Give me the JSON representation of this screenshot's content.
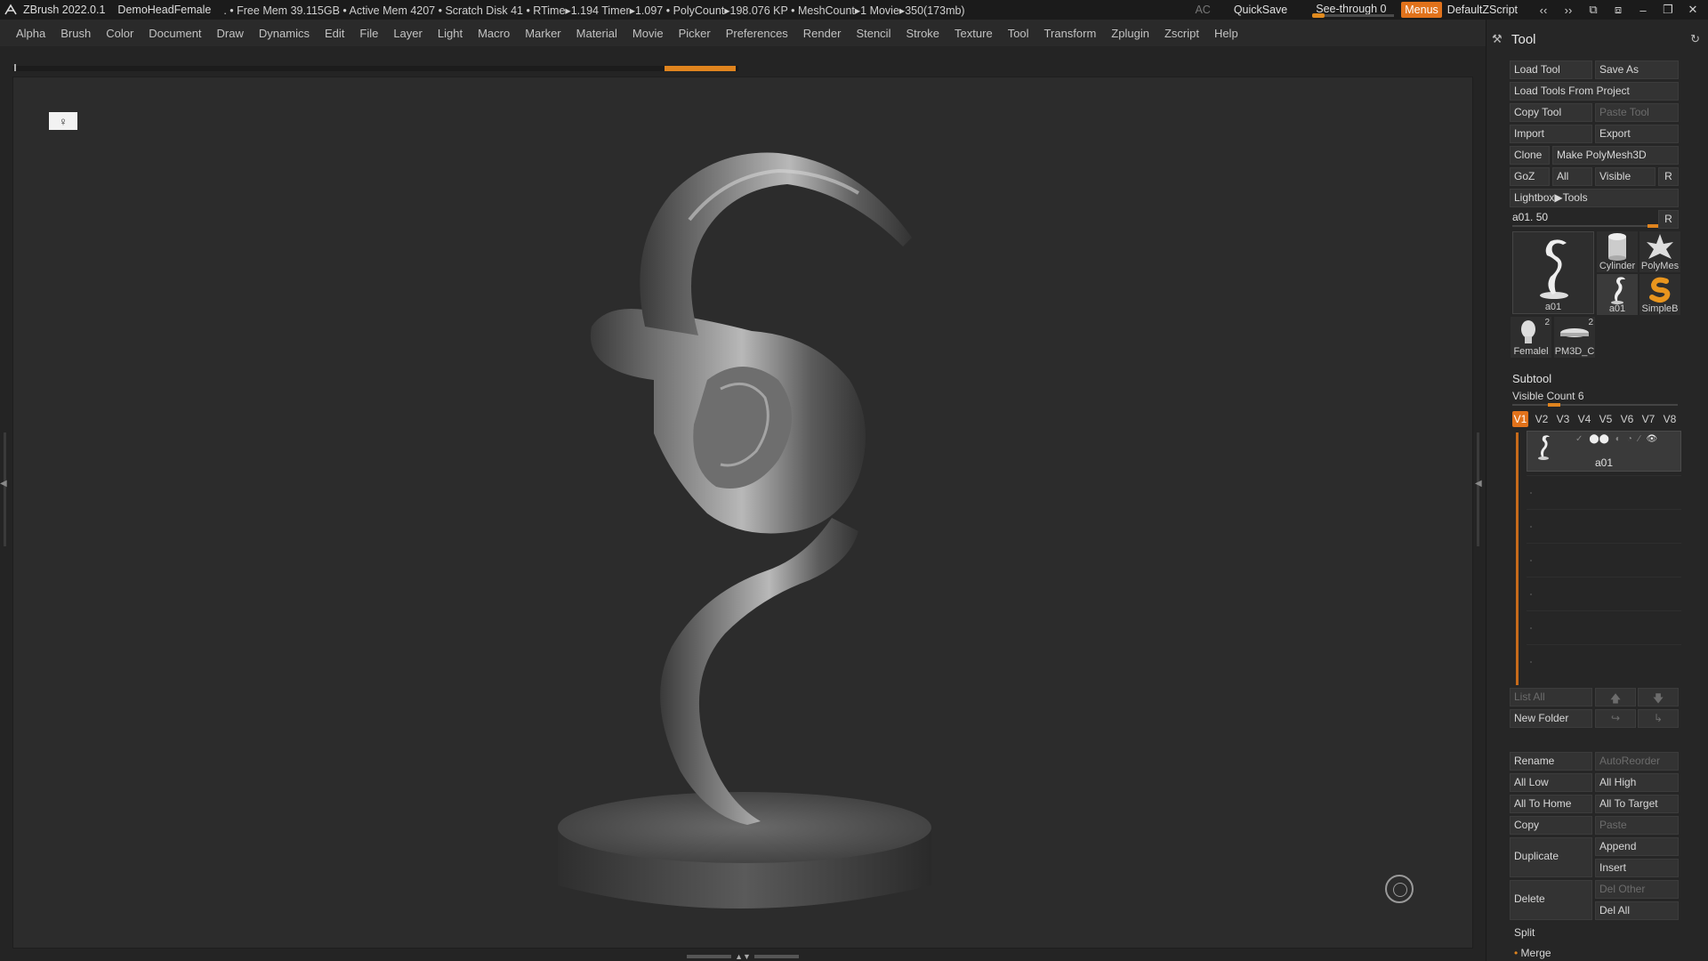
{
  "titlebar": {
    "app": "ZBrush 2022.0.1",
    "document": "DemoHeadFemale",
    "stats": ". • Free Mem 39.115GB • Active Mem 4207 • Scratch Disk 41 •  RTime▸1.194 Timer▸1.097 • PolyCount▸198.076 KP  • MeshCount▸1  Movie▸350(173mb)",
    "ac": "AC",
    "quicksave": "QuickSave",
    "see_through_label": "See-through  0",
    "see_through_value": 0,
    "menus": "Menus",
    "default_zscript": "DefaultZScript"
  },
  "menubar": [
    "Alpha",
    "Brush",
    "Color",
    "Document",
    "Draw",
    "Dynamics",
    "Edit",
    "File",
    "Layer",
    "Light",
    "Macro",
    "Marker",
    "Material",
    "Movie",
    "Picker",
    "Preferences",
    "Render",
    "Stencil",
    "Stroke",
    "Texture",
    "Tool",
    "Transform",
    "Zplugin",
    "Zscript",
    "Help"
  ],
  "viewport": {
    "perspective_icon_glyph": "♀"
  },
  "tool_panel": {
    "title": "Tool",
    "load_tool": "Load Tool",
    "save_as": "Save As",
    "load_tools_from_project": "Load Tools From Project",
    "copy_tool": "Copy Tool",
    "paste_tool": "Paste Tool",
    "import": "Import",
    "export": "Export",
    "clone": "Clone",
    "make_polymesh": "Make PolyMesh3D",
    "goz": "GoZ",
    "all": "All",
    "visible": "Visible",
    "r": "R",
    "lightbox_tools": "Lightbox▶Tools",
    "slider_label": "a01. 50",
    "slider_value": 50,
    "thumbnails": {
      "main": "a01",
      "cylinder": "Cylinder",
      "polymesh": "PolyMes",
      "a01_small": "a01",
      "simpleb": "SimpleB",
      "female": "Femalel",
      "female_count": "2",
      "pm3d": "PM3D_C",
      "pm3d_count": "2"
    }
  },
  "subtool": {
    "header": "Subtool",
    "visible_count": "Visible Count 6",
    "versions": [
      "V1",
      "V2",
      "V3",
      "V4",
      "V5",
      "V6",
      "V7",
      "V8"
    ],
    "active_version": "V1",
    "item_name": "a01",
    "list_all": "List All",
    "new_folder": "New Folder",
    "rename": "Rename",
    "auto_reorder": "AutoReorder",
    "all_low": "All Low",
    "all_high": "All High",
    "all_to_home": "All To Home",
    "all_to_target": "All To Target",
    "copy": "Copy",
    "paste": "Paste",
    "duplicate": "Duplicate",
    "append": "Append",
    "insert": "Insert",
    "delete": "Delete",
    "del_other": "Del Other",
    "del_all": "Del All",
    "split": "Split",
    "merge": "Merge"
  }
}
